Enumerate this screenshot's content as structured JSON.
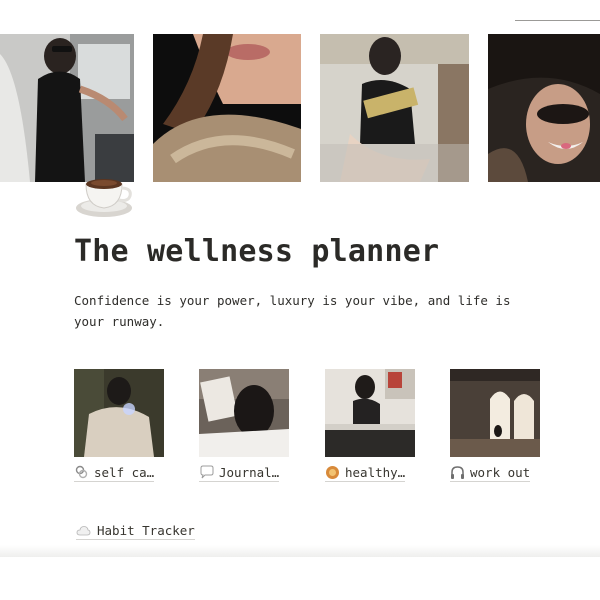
{
  "cover": {
    "images": [
      {
        "name": "cover-photo-car",
        "alt": "woman in sunglasses by car"
      },
      {
        "name": "cover-photo-fur",
        "alt": "woman in fur coat close-up"
      },
      {
        "name": "cover-photo-reading",
        "alt": "woman reading a book"
      },
      {
        "name": "cover-photo-hat",
        "alt": "woman in fur hat laughing"
      }
    ]
  },
  "page": {
    "icon": "coffee-cup-icon",
    "title": "The wellness planner",
    "quote": "Confidence is your power, luxury is your vibe, and life is your runway."
  },
  "gallery": {
    "items": [
      {
        "label": "self ca…",
        "icon": "ribbon-icon"
      },
      {
        "label": "Journal…",
        "icon": "speech-bubble-icon"
      },
      {
        "label": "healthy…",
        "icon": "food-icon"
      },
      {
        "label": "work out",
        "icon": "headphones-icon"
      }
    ]
  },
  "links": {
    "habit_tracker": {
      "label": "Habit Tracker",
      "icon": "cloud-icon"
    }
  }
}
